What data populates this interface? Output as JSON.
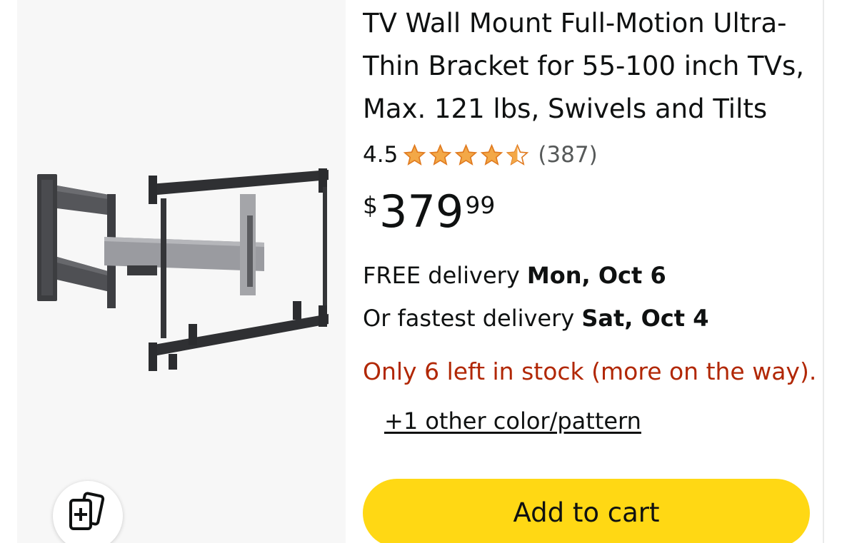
{
  "product": {
    "title": "TV Wall Mount Full-Motion Ultra-Thin Bracket for 55-100 inch TVs, Max. 121 lbs, Swivels and Tilts",
    "rating_value": "4.5",
    "rating_stars": 4.5,
    "review_count": "(387)",
    "price": {
      "symbol": "$",
      "whole": "379",
      "fraction": "99"
    },
    "delivery": {
      "free_prefix": "FREE delivery ",
      "free_date": "Mon, Oct 6",
      "fast_prefix": "Or fastest delivery ",
      "fast_date": "Sat, Oct 4"
    },
    "stock_text": "Only 6 left in stock (more on the way).",
    "variants_link": "+1 other color/pattern",
    "add_to_cart_label": "Add to cart"
  },
  "icons": {
    "star": "star-icon",
    "compare": "compare-add-icon"
  },
  "colors": {
    "star": "#f3a847",
    "star_dark": "#e07a1f",
    "stock": "#b12704",
    "add_to_cart": "#ffd814",
    "image_bg": "#f7f7f7"
  }
}
